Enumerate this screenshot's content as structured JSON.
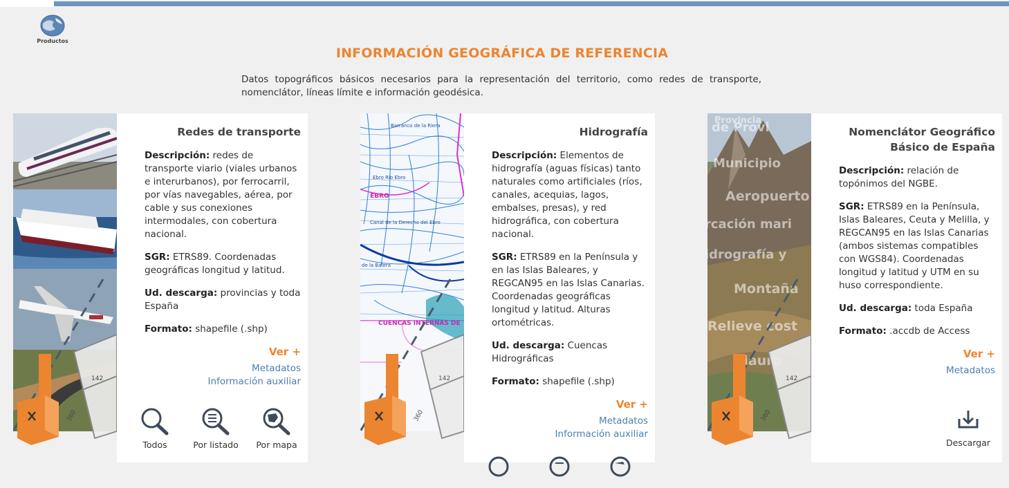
{
  "header": {
    "logo_label": "Productos"
  },
  "page": {
    "title": "INFORMACIÓN GEOGRÁFICA DE REFERENCIA",
    "intro": "Datos topográficos básicos necesarios para la representación del territorio, como redes de transporte, nomenclátor, líneas límite e información geodésica."
  },
  "cards": [
    {
      "title": "Redes de transporte",
      "desc_label": "Descripción:",
      "desc": " redes de transporte viario (viales urbanos e interurbanos), por ferrocarril, por vías navegables, aérea, por cable y sus conexiones intermodales, con cobertura nacional.",
      "sgr_label": "SGR:",
      "sgr": " ETRS89. Coordenadas geográficas longitud y latitud.",
      "ud_label": "Ud. descarga:",
      "ud": " provincias y toda España",
      "fmt_label": "Formato:",
      "fmt": " shapefile (.shp)",
      "ver": "Ver +",
      "link1": "Metadatos",
      "link2": "Información auxiliar",
      "btn_all": "Todos",
      "btn_list": "Por listado",
      "btn_map": "Por mapa"
    },
    {
      "title": "Hidrografía",
      "desc_label": "Descripción:",
      "desc": " Elementos de hidrografía (aguas físicas) tanto naturales como artificiales (ríos, canales, acequias, lagos, embalses, presas), y red hidrográfica, con cobertura nacional.",
      "sgr_label": "SGR:",
      "sgr": " ETRS89 en la Península y en las Islas Baleares, y REGCAN95 en las Islas Canarias. Coordenadas geográficas longitud y latitud. Alturas ortométricas.",
      "ud_label": "Ud. descarga:",
      "ud": " Cuencas Hidrográficas",
      "fmt_label": "Formato:",
      "fmt": " shapefile (.shp)",
      "ver": "Ver +",
      "link1": "Metadatos",
      "link2": "Información auxiliar",
      "map_labels": [
        "Barranco de la Riera",
        "Ebro Río Ebro",
        "EBRO",
        "Canal de la Derecha del Ebro",
        "de la Balera",
        "CUENCAS INTERNAS DE"
      ]
    },
    {
      "title": "Nomenclátor Geográfico Básico de España",
      "desc_label": "Descripción:",
      "desc": " relación de topónimos del NGBE.",
      "sgr_label": "SGR:",
      "sgr": " ETRS89 en la Península, Islas Baleares, Ceuta y Melilla, y REGCAN95 en las Islas Canarias (ambos sistemas compatibles con WGS84). Coordenadas longitud y latitud y UTM en su huso correspondiente.",
      "ud_label": "Ud. descarga:",
      "ud": " toda España",
      "fmt_label": "Formato:",
      "fmt": " .accdb de Access",
      "ver": "Ver +",
      "link1": "Metadatos",
      "btn_download": "Descargar",
      "overlay_words": [
        "Provincia",
        "de Provi",
        "Municipio",
        "Aeropuerto",
        "rcación mari",
        "idrografía y",
        "Montaña",
        "Relieve cost",
        "Viaurb"
      ]
    }
  ],
  "sheet_numbers": [
    "142",
    "360"
  ],
  "colors": {
    "accent": "#ec8530",
    "link": "#4a7fb0",
    "topbar": "#6d95c0"
  }
}
